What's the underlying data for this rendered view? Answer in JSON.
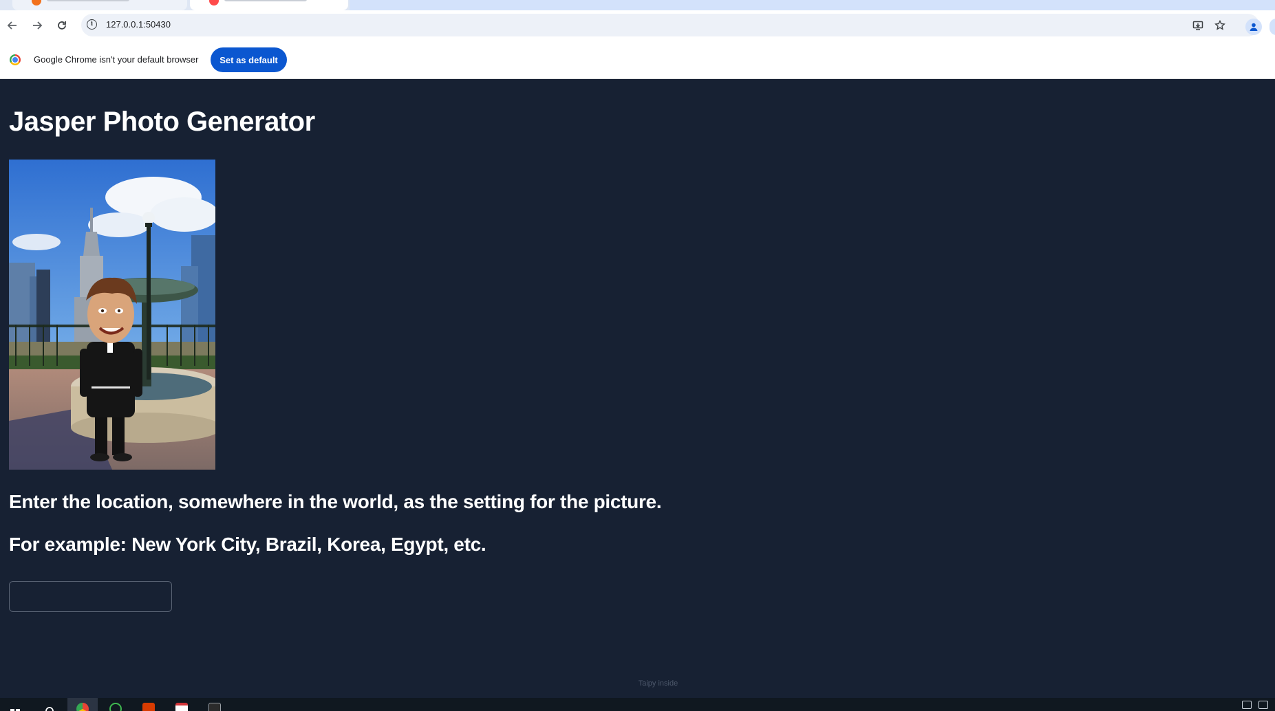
{
  "browser": {
    "url": "127.0.0.1:50430",
    "icons": {
      "back": "arrow-left-icon",
      "forward": "arrow-right-icon",
      "reload": "reload-icon",
      "site_info": "info-icon",
      "install": "install-app-icon",
      "bookmark": "star-icon",
      "profile": "profile-icon"
    }
  },
  "infobar": {
    "message": "Google Chrome isn't your default browser",
    "button": "Set as default"
  },
  "page": {
    "title": "Jasper Photo Generator",
    "prompt_line1": "Enter the location, somewhere in the world, as the setting for the picture.",
    "prompt_line2": "For example: New York City, Brazil, Korea, Egypt, etc.",
    "input_value": "",
    "footer": "Taipy inside"
  },
  "colors": {
    "page_bg": "#172133",
    "accent": "#0b57d0",
    "text": "#ffffff"
  }
}
